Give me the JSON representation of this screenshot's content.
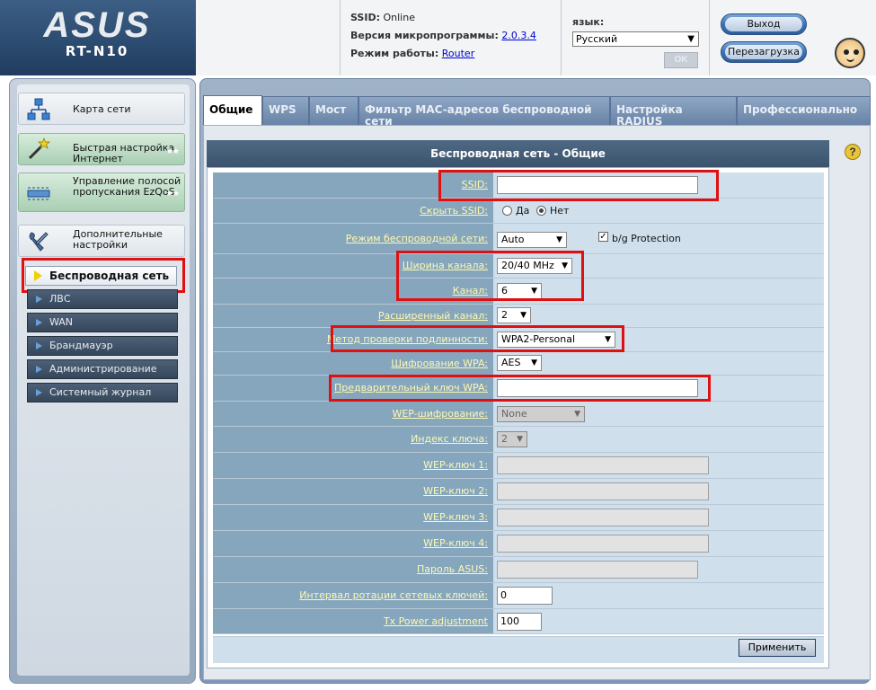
{
  "header": {
    "brand": "ASUS",
    "model": "RT-N10",
    "ssid_label": "SSID:",
    "ssid_value": "Online",
    "firmware_label": "Версия микропрограммы:",
    "firmware_value": "2.0.3.4",
    "mode_label": "Режим работы:",
    "mode_value": "Router",
    "language_label": "язык:",
    "language_value": "Русский",
    "ok_label": "OK",
    "logout_label": "Выход",
    "reboot_label": "Перезагрузка"
  },
  "sidebar": {
    "items": [
      {
        "label": "Карта сети",
        "icon": "network-map-icon"
      },
      {
        "label": "Быстрая настройка Интернет",
        "icon": "magic-wand-icon"
      },
      {
        "label": "Управление полосой пропускания EzQoS",
        "icon": "bandwidth-icon"
      },
      {
        "label": "Дополнительные настройки",
        "icon": "tools-icon"
      }
    ],
    "submenu": [
      {
        "label": "Беспроводная сеть",
        "active": true
      },
      {
        "label": "ЛВС"
      },
      {
        "label": "WAN"
      },
      {
        "label": "Брандмауэр"
      },
      {
        "label": "Администрирование"
      },
      {
        "label": "Системный журнал"
      }
    ]
  },
  "tabs": [
    {
      "label": "Общие",
      "active": true
    },
    {
      "label": "WPS"
    },
    {
      "label": "Мост"
    },
    {
      "label": "Фильтр MAC-адресов беспроводной сети"
    },
    {
      "label": "Настройка RADIUS"
    },
    {
      "label": "Профессионально"
    }
  ],
  "panel_title": "Беспроводная сеть - Общие",
  "form": {
    "ssid": {
      "label": "SSID:",
      "value": ""
    },
    "hide_ssid": {
      "label": "Скрыть SSID:",
      "yes": "Да",
      "no": "Нет",
      "selected": "Нет"
    },
    "wireless_mode": {
      "label": "Режим беспроводной сети:",
      "value": "Auto",
      "bg_protection": "b/g Protection",
      "bg_protection_checked": true
    },
    "channel_width": {
      "label": "Ширина канала:",
      "value": "20/40 MHz"
    },
    "channel": {
      "label": "Канал:",
      "value": "6"
    },
    "extension_channel": {
      "label": "Расширенный канал:",
      "value": "2"
    },
    "auth_method": {
      "label": "Метод проверки подлинности:",
      "value": "WPA2-Personal"
    },
    "wpa_encryption": {
      "label": "Шифрование WPA:",
      "value": "AES"
    },
    "wpa_key": {
      "label": "Предварительный ключ WPA:",
      "value": ""
    },
    "wep_encryption": {
      "label": "WEP-шифрование:",
      "value": "None"
    },
    "key_index": {
      "label": "Индекс ключа:",
      "value": "2"
    },
    "wep_key1": {
      "label": "WEP-ключ 1:",
      "value": ""
    },
    "wep_key2": {
      "label": "WEP-ключ 2:",
      "value": ""
    },
    "wep_key3": {
      "label": "WEP-ключ 3:",
      "value": ""
    },
    "wep_key4": {
      "label": "WEP-ключ 4:",
      "value": ""
    },
    "asus_password": {
      "label": "Пароль ASUS:",
      "value": ""
    },
    "key_rotation": {
      "label": "Интервал ротации сетевых ключей:",
      "value": "0"
    },
    "tx_power": {
      "label": "Tx Power adjustment",
      "value": "100"
    }
  },
  "apply_label": "Применить",
  "help_label": "?",
  "colors": {
    "highlight": "#e01010",
    "label_bg": "#86a6bd",
    "label_text": "#fff9b0",
    "value_bg": "#cfe0ec"
  }
}
